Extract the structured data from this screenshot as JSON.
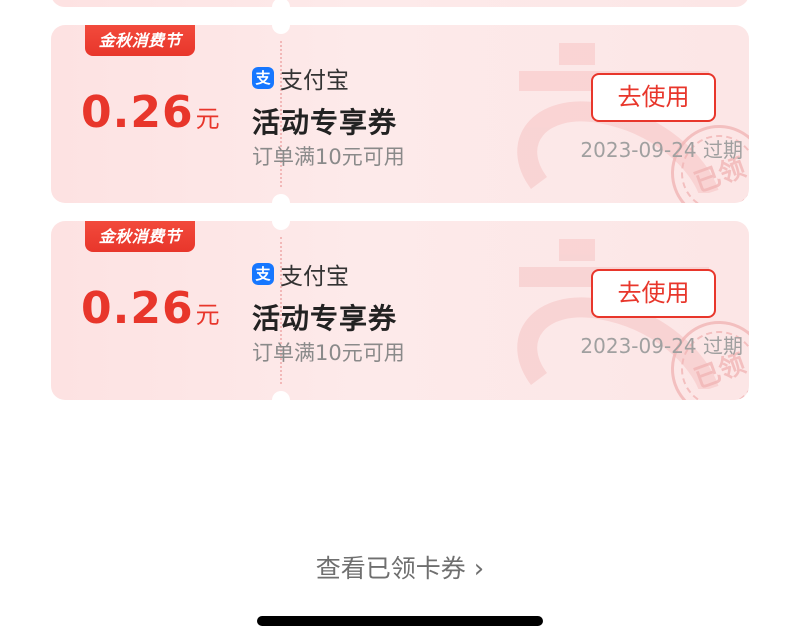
{
  "colors": {
    "accent_red": "#e8362b",
    "card_bg": "#fde2e2",
    "alipay_blue": "#1677ff"
  },
  "coupons": [
    {
      "badge": "金秋消费节",
      "amount": "0.26",
      "unit": "元",
      "brand_icon": "alipay-icon",
      "brand_icon_glyph": "支",
      "brand": "支付宝",
      "title": "活动专享券",
      "condition": "订单满10元可用",
      "button": "去使用",
      "expiry": "2023-09-24 过期",
      "seal_text": "已领"
    },
    {
      "badge": "金秋消费节",
      "amount": "0.26",
      "unit": "元",
      "brand_icon": "alipay-icon",
      "brand_icon_glyph": "支",
      "brand": "支付宝",
      "title": "活动专享券",
      "condition": "订单满10元可用",
      "button": "去使用",
      "expiry": "2023-09-24 过期",
      "seal_text": "已领"
    }
  ],
  "footer": {
    "view_link": "查看已领卡券",
    "chevron_icon": "chevron-right-icon",
    "chevron_glyph": "›"
  }
}
